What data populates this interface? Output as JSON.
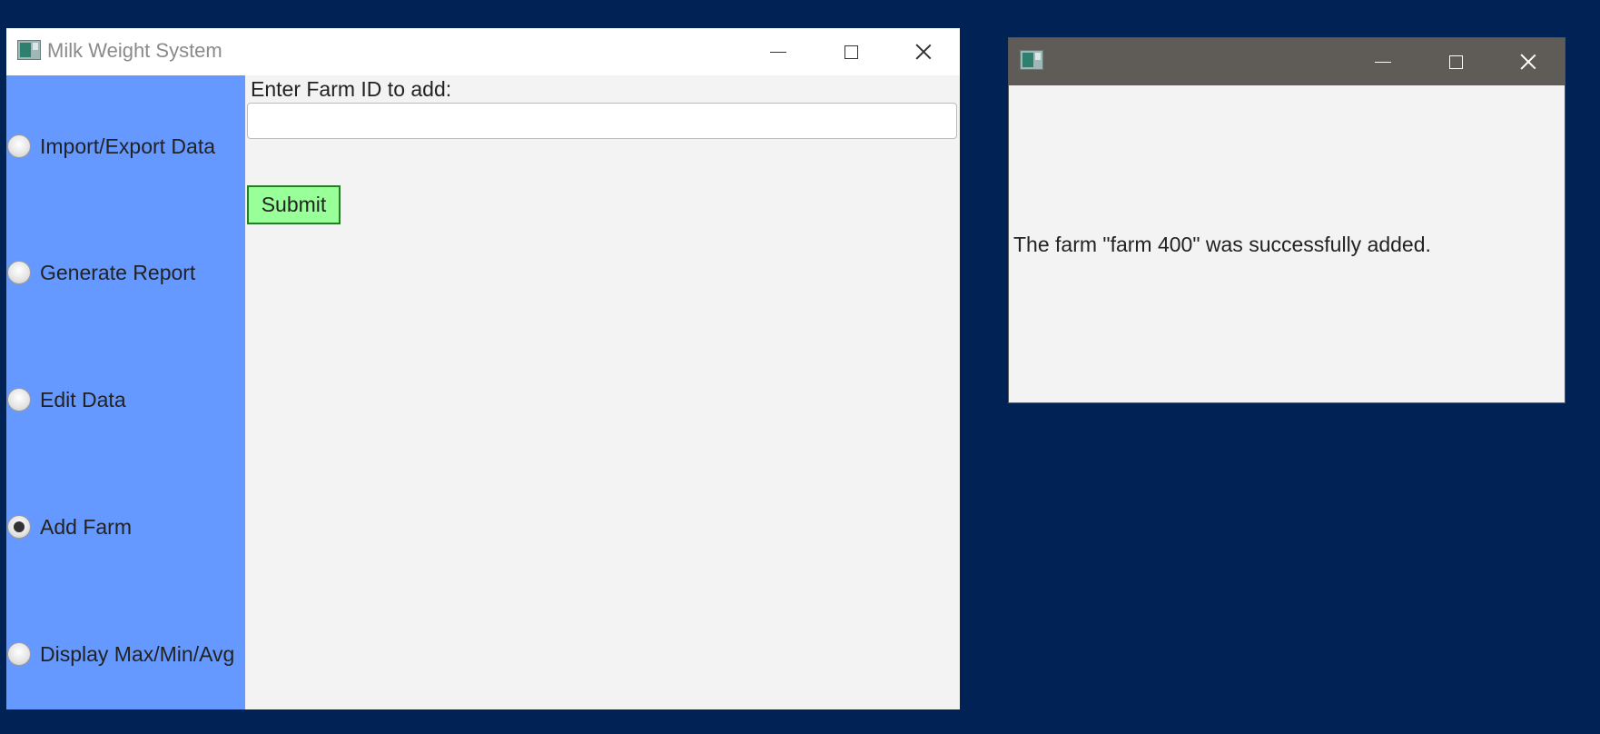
{
  "main_window": {
    "title": "Milk Weight System",
    "sidebar": {
      "options": [
        {
          "label": "Import/Export Data",
          "checked": false
        },
        {
          "label": "Generate Report",
          "checked": false
        },
        {
          "label": "Edit Data",
          "checked": false
        },
        {
          "label": "Add Farm",
          "checked": true
        },
        {
          "label": "Display Max/Min/Avg",
          "checked": false
        }
      ]
    },
    "content": {
      "prompt": "Enter Farm ID to add:",
      "farm_id_value": "",
      "submit_label": "Submit"
    }
  },
  "popup_window": {
    "title": "",
    "message": "The farm \"farm 400\" was successfully added."
  },
  "colors": {
    "desktop": "#002254",
    "sidebar": "#6699ff",
    "submit_button": "#99ff99",
    "popup_titlebar": "#5f5b57"
  },
  "icons": {
    "window_icon": "app-window-icon",
    "minimize": "minimize-icon",
    "maximize": "maximize-icon",
    "close": "close-icon"
  }
}
